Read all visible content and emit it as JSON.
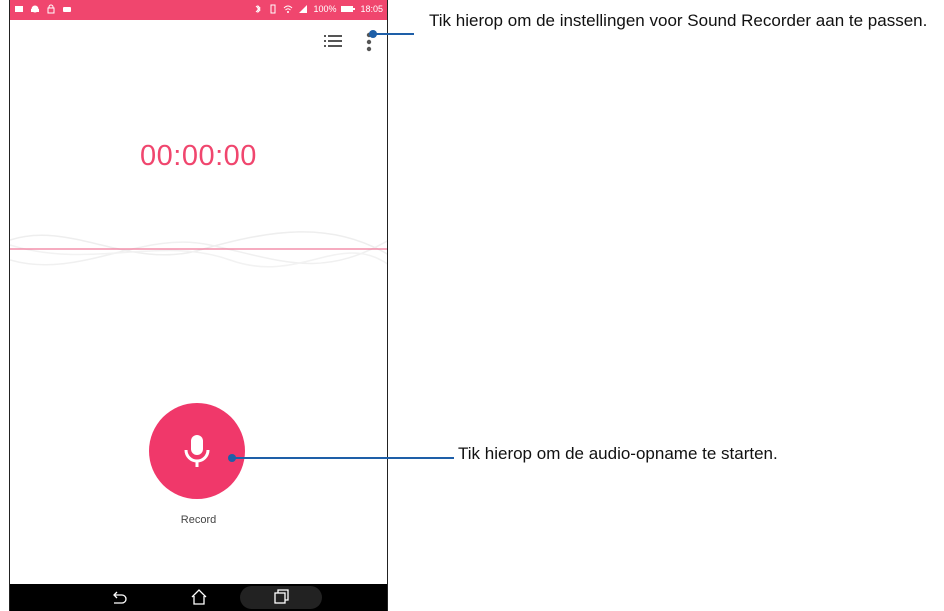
{
  "status_bar": {
    "left_icons": [
      "gallery-icon",
      "cloud-icon",
      "lock-icon",
      "app-icon"
    ],
    "battery": "100%",
    "time": "18:05"
  },
  "toolbar": {
    "list_icon": "list-icon",
    "more_icon": "more-vertical-icon"
  },
  "recorder": {
    "timer": "00:00:00",
    "record_label": "Record"
  },
  "nav": [
    "back-icon",
    "home-icon",
    "recents-icon"
  ],
  "callouts": {
    "settings": "Tik hierop om de instellingen voor Sound Recorder aan te passen.",
    "record": "Tik hierop om de audio-opname te starten."
  },
  "colors": {
    "accent": "#f0466e",
    "callout_line": "#1e5fa8"
  }
}
